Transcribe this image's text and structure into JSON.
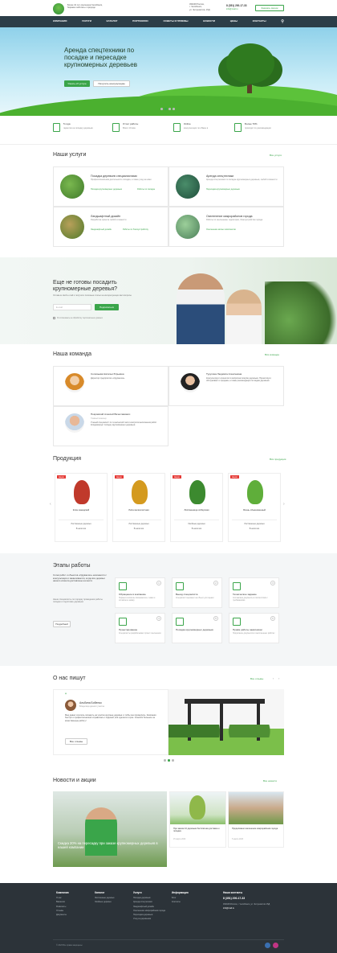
{
  "header": {
    "company": "Более 10 лет озеленяем Челябинск, бережно заботясь о природе",
    "address_line1": "454048 Россия,",
    "address_line2": "г. Челябинск,",
    "address_line3": "ул. Энтузиастов, 15Д",
    "phone": "8 (351) 200-17-33",
    "email": "info@mail.ru",
    "callback": "Заказать звонок"
  },
  "nav": [
    "КОМПАНИЯ",
    "УСЛУГИ",
    "КАТАЛОГ",
    "ПОРТФОЛИО",
    "СОВЕТЫ И ПРИЕМЫ",
    "НОВОСТИ",
    "ЦЕНЫ",
    "КОНТАКТЫ"
  ],
  "hero": {
    "title": "Аренда спецтехники по посадке и пересадке крупномерных деревьев",
    "primary_btn": "Узнать об услуге",
    "secondary_btn": "Получить консультацию"
  },
  "features": [
    {
      "title": "5 года",
      "sub": "гарантия на посадку деревьев"
    },
    {
      "title": "Отчет работы",
      "sub": "Всего 10 мин"
    },
    {
      "title": "Online",
      "sub": "консультации по обмен в"
    },
    {
      "title": "Более 70%",
      "sub": "приходят по рекомендации"
    }
  ],
  "services": {
    "title": "Наши услуги",
    "more": "Все услуги",
    "items": [
      {
        "title": "Посадка деревьев специалистами",
        "desc": "Профессиональная деятельность посадка, а также уход за ними",
        "links": [
          "Посадка крупномерных деревьев",
          "Работы по посадке"
        ]
      },
      {
        "title": "Аренда спецтехники",
        "desc": "Аренда спецтехники по посадке крупномерных деревьев, любой сложности",
        "links": [
          "Пересадка крупномерных деревьев"
        ]
      },
      {
        "title": "Ландшафтный дизайн",
        "desc": "Разработка проекта любой сложности",
        "links": [
          "Ландшафтный дизайн",
          "Работы по благоустройству"
        ]
      },
      {
        "title": "Озеленение микрорайонов города",
        "desc": "Работы по озеленению территории, благоустройство города",
        "links": [
          "Озеленение жилых комплексов"
        ]
      }
    ]
  },
  "cta": {
    "title": "Еще не готовы посадить крупномерные деревья?",
    "desc": "Оставьте свой e-mail и получите полезные статьи на интересующие вас вопросы",
    "email_placeholder": "E-mail",
    "submit": "Подписаться",
    "consent": "Я соглашаюсь на обработку персональных данных"
  },
  "team": {
    "title": "Наша команда",
    "more": "Вся команда",
    "members": [
      {
        "name": "Соловьева Наталья Юрьевна",
        "role": "",
        "desc": "Директор предприятия «Одуванчик»"
      },
      {
        "name": "Турулина Людмила Алексеевна",
        "role": "",
        "desc": "Консультирует клиентов по вопросам покупки деревьев. Проектирует, обслуживает и продажа, а также рекомендации по видам деревьев"
      },
      {
        "name": "Покровский Алексей Вячеславович",
        "role": "Главный инженер",
        "desc": "Ученый специалист по технической части контроля выполнения работ. Координирует посадку крупномерных деревьев"
      }
    ]
  },
  "products": {
    "title": "Продукция",
    "more": "Вся продукция",
    "badge": "Акция",
    "items": [
      {
        "name": "Клён канадский",
        "type": "Лиственные деревья",
        "stock": "В наличии",
        "color": "#c0392b"
      },
      {
        "name": "Липа мелколистная",
        "type": "Лиственные деревья",
        "stock": "В наличии",
        "color": "#d49a1f"
      },
      {
        "name": "Лиственница сибирская",
        "type": "Хвойные деревья",
        "stock": "В наличии",
        "color": "#3c8a2f"
      },
      {
        "name": "Ясень обыкновенный",
        "type": "Лиственные деревья",
        "stock": "В наличии",
        "color": "#5fae3a"
      }
    ]
  },
  "stages": {
    "title": "Этапы работы",
    "desc": "Сотни работ и объектов «Одуванчик» начинается с консультации и заканчивается, когда все деревья нашего клиента доставлены на место",
    "desc2": "Наши специалисты по порядку проведения работы посадок и подготовке деревьев",
    "button": "Подробней",
    "items": [
      {
        "n": "1",
        "title": "Обращение в компанию",
        "desc": "Первым этапом вы связываетесь с нами и оставляете заявку"
      },
      {
        "n": "2",
        "title": "Выезд специалиста",
        "desc": "Специалист выезжает на объект для оценки"
      },
      {
        "n": "3",
        "title": "Техническое задание",
        "desc": "Составляем документы в соответствии с требованиями"
      },
      {
        "n": "4",
        "title": "Проектирование",
        "desc": "Специалисты разрабатывают проект озеленения"
      },
      {
        "n": "5",
        "title": "Посадка крупномерных деревьев",
        "desc": ""
      },
      {
        "n": "6",
        "title": "Приём работы заказчиком",
        "desc": "Подписание документов о выполненных работах"
      }
    ]
  },
  "reviews": {
    "title": "О нас пишут",
    "more": "Все отзывы",
    "name": "Альбина Бобенко",
    "role": "Владелица дачного участка",
    "text": "Мне давно хотелось посадить на участке крупные деревья и чтобы они прижились. Компания быстро и профессионально справилась с задачей, всё сделали в срок. Спасибо большое за качественную работу!",
    "button": "Все отзывы"
  },
  "news": {
    "title": "Новости и акции",
    "more": "Все новости",
    "main_title": "Скидка 20% на пересадку при заказе крупномерных деревьев в нашей компании",
    "items": [
      {
        "title": "При заказе 10 деревьев бесплатная доставка и посадка",
        "date": "15 марта 2023"
      },
      {
        "title": "Продолжаем озеленение микрорайонов города",
        "date": "5 марта 2023"
      }
    ]
  },
  "footer": {
    "cols": [
      {
        "h": "Компания",
        "items": [
          "О нас",
          "Вакансии",
          "Реквизиты",
          "Отзывы",
          "Документы"
        ]
      },
      {
        "h": "Каталог",
        "items": [
          "Лиственные деревья",
          "Хвойные деревья"
        ]
      },
      {
        "h": "Услуги",
        "items": [
          "Посадка деревьев",
          "Аренда спецтехники",
          "Ландшафтный дизайн",
          "Озеленение микрорайонов города",
          "Пересадка деревьев",
          "Уход за деревьями"
        ]
      },
      {
        "h": "Информация",
        "items": [
          "Блог",
          "Контакты"
        ]
      }
    ],
    "contacts_h": "Наши контакты",
    "phone": "8 (351) 200-17-33",
    "address": "454048 Россия, г. Челябинск, ул. Энтузиастов 15Д",
    "email": "info@mail.ru",
    "copyright": "© 2023 Все права защищены"
  },
  "colors": {
    "accent": "#3aa54a",
    "dark": "#2c3e48"
  }
}
